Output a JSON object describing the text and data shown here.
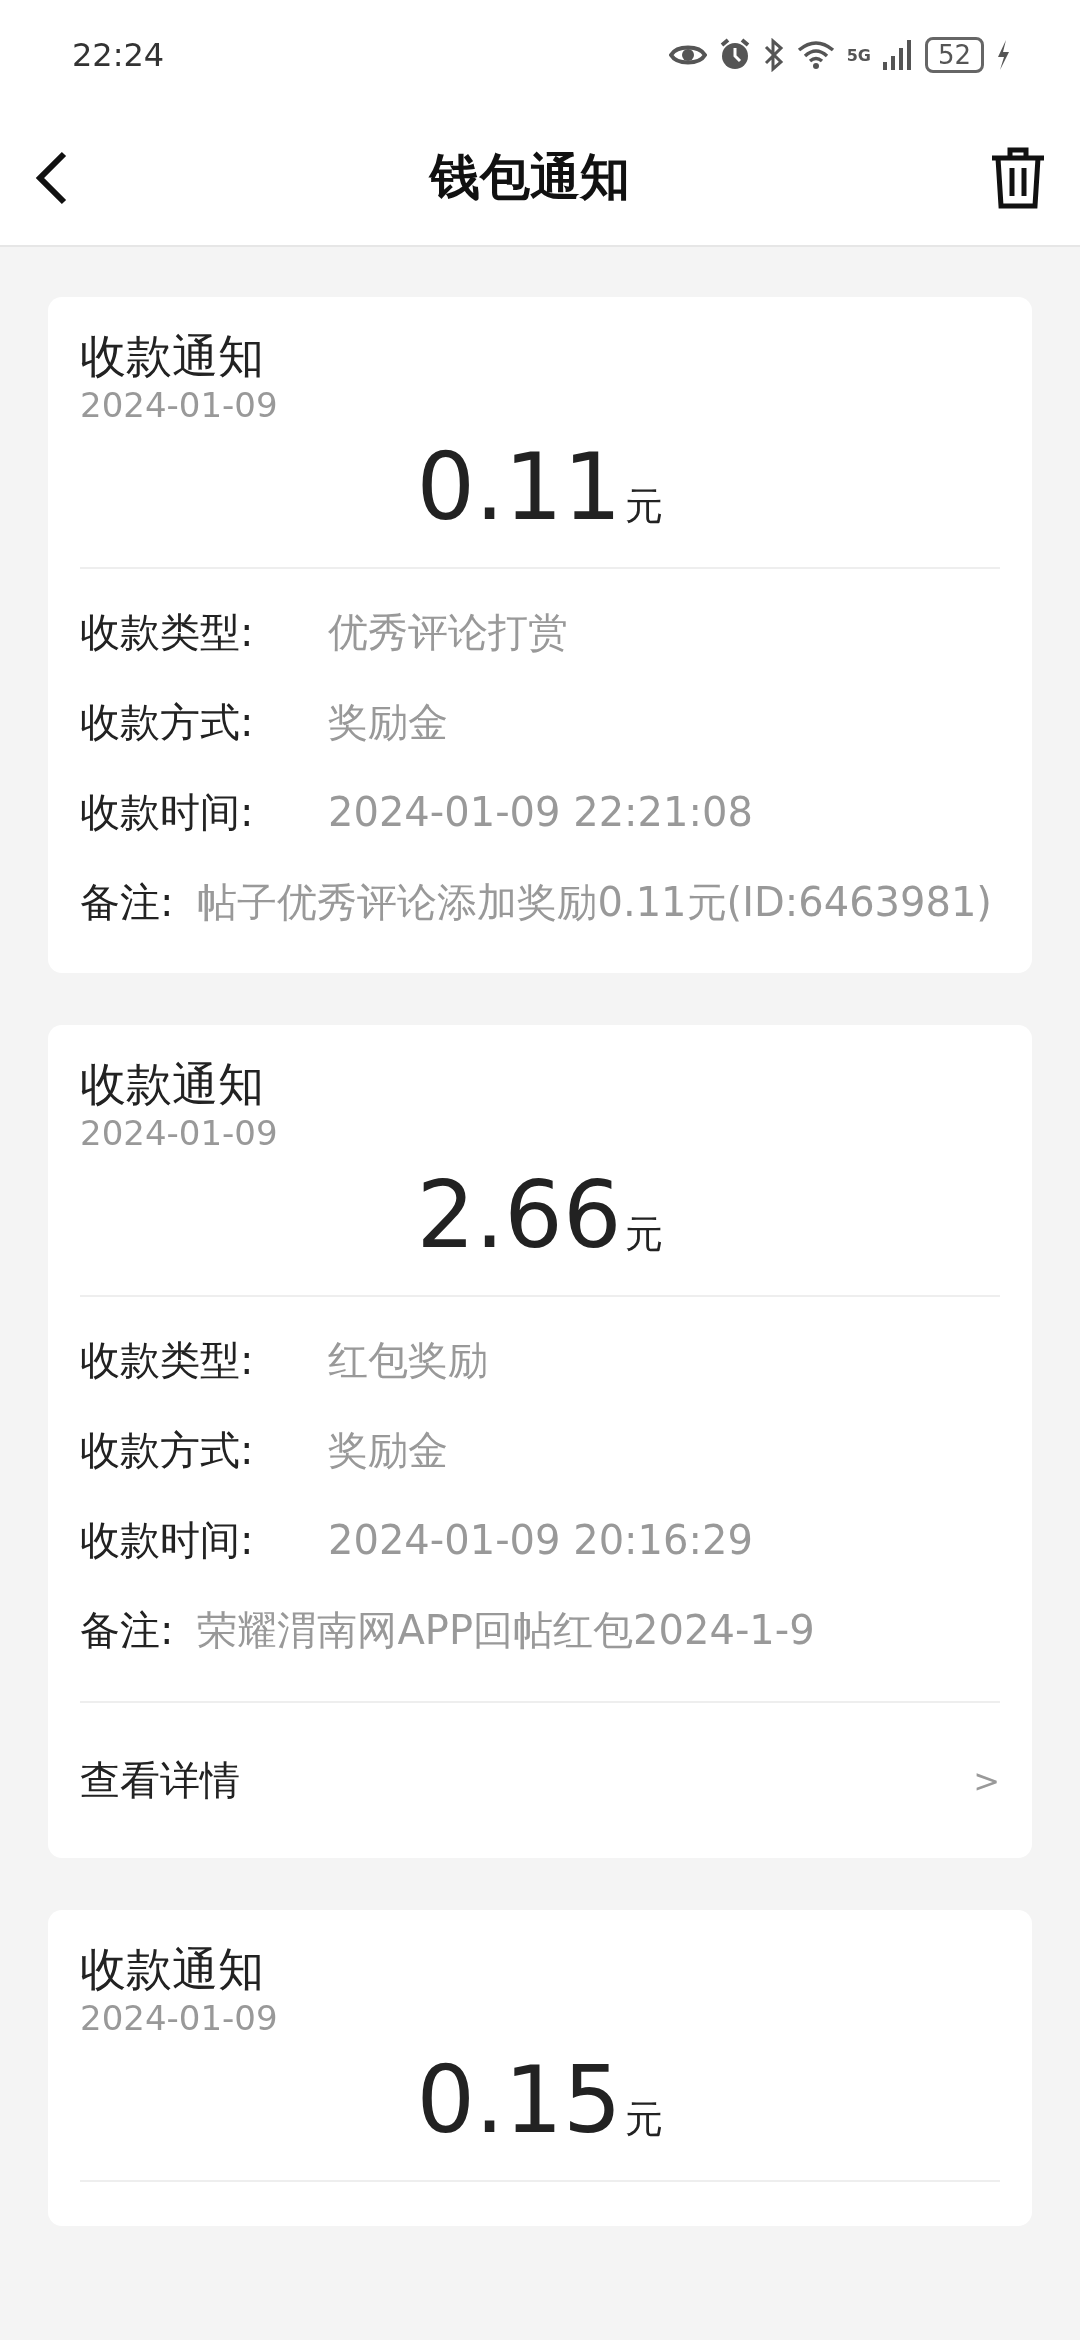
{
  "status_bar": {
    "time": "22:24",
    "network": "5G",
    "battery": "52"
  },
  "header": {
    "title": "钱包通知"
  },
  "notices": [
    {
      "title": "收款通知",
      "date": "2024-01-09",
      "amount": "0.11",
      "unit": "元",
      "fields": [
        {
          "label": "收款类型:",
          "value": "优秀评论打赏"
        },
        {
          "label": "收款方式:",
          "value": "奖励金"
        },
        {
          "label": "收款时间:",
          "value": "2024-01-09 22:21:08"
        },
        {
          "label": "备注:",
          "value": "帖子优秀评论添加奖励0.11元(ID:6463981)"
        }
      ]
    },
    {
      "title": "收款通知",
      "date": "2024-01-09",
      "amount": "2.66",
      "unit": "元",
      "fields": [
        {
          "label": "收款类型:",
          "value": "红包奖励"
        },
        {
          "label": "收款方式:",
          "value": "奖励金"
        },
        {
          "label": "收款时间:",
          "value": "2024-01-09 20:16:29"
        },
        {
          "label": "备注:",
          "value": "荣耀渭南网APP回帖红包2024-1-9"
        }
      ],
      "details": {
        "label": "查看详情",
        "arrow": ">"
      }
    },
    {
      "title": "收款通知",
      "date": "2024-01-09",
      "amount": "0.15",
      "unit": "元"
    }
  ]
}
